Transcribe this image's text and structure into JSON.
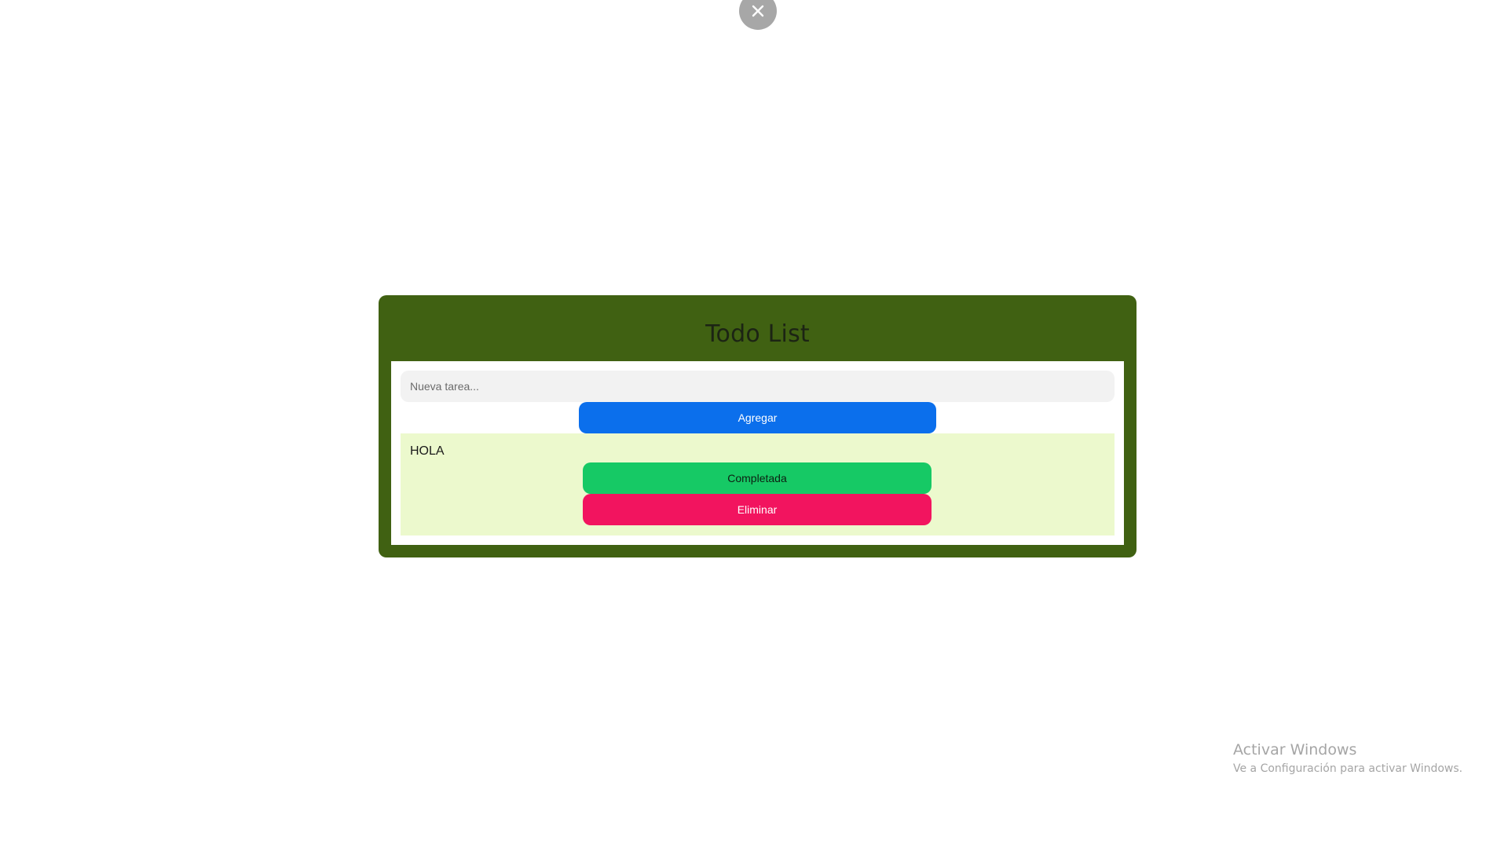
{
  "close_button": {
    "icon": "close-icon"
  },
  "app": {
    "title": "Todo List",
    "input_placeholder": "Nueva tarea...",
    "input_value": "",
    "add_label": "Agregar"
  },
  "tasks": [
    {
      "text": "HOLA",
      "complete_label": "Completada",
      "delete_label": "Eliminar"
    }
  ],
  "watermark": {
    "title": "Activar Windows",
    "subtitle": "Ve a Configuración para activar Windows."
  },
  "colors": {
    "card_bg": "#406112",
    "add_button": "#0b6fec",
    "complete_button": "#16c965",
    "delete_button": "#f2145f",
    "task_bg": "#ecf9cd",
    "close_circle": "#a7a7a7"
  }
}
